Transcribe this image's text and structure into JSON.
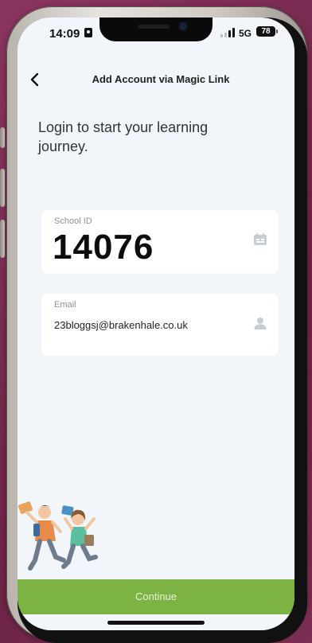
{
  "status_bar": {
    "time": "14:09",
    "network": "5G",
    "battery": "78"
  },
  "header": {
    "title": "Add Account via Magic Link",
    "back_icon": "chevron-left-icon"
  },
  "headline": "Login to start your learning journey.",
  "form": {
    "school_id": {
      "label": "School ID",
      "value": "14076",
      "icon": "id-card-icon"
    },
    "email": {
      "label": "Email",
      "value": "23bloggsj@brakenhale.co.uk",
      "icon": "person-icon"
    }
  },
  "continue_label": "Continue",
  "colors": {
    "accent": "#7cb342",
    "background": "#f2f5f9",
    "card": "#ffffff"
  }
}
